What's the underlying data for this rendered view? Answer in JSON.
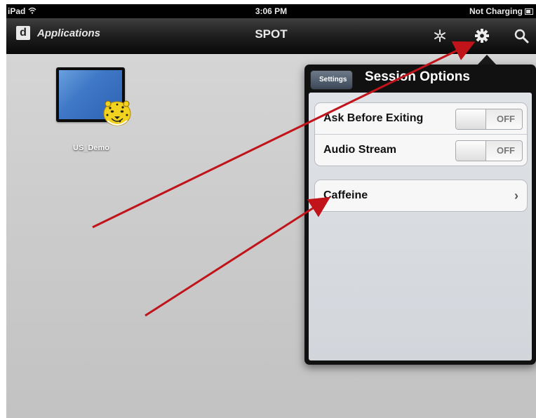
{
  "status_bar": {
    "device": "iPad",
    "time": "3:06 PM",
    "battery_text": "Not Charging"
  },
  "nav_bar": {
    "app_button_label": "Applications",
    "logo_letter": "d",
    "title": "SPOT",
    "icons": [
      "snowflake-icon",
      "gear-icon",
      "search-icon"
    ]
  },
  "desktop": {
    "icon_label": "US_Demo"
  },
  "popover": {
    "back_label": "Settings",
    "title": "Session Options",
    "toggles": [
      {
        "label": "Ask Before Exiting",
        "state": "OFF"
      },
      {
        "label": "Audio Stream",
        "state": "OFF"
      }
    ],
    "nav_rows": [
      {
        "label": "Caffeine"
      }
    ]
  },
  "colors": {
    "annotation_arrow": "#c0141a",
    "nav_bar": "#1c1c1c"
  }
}
